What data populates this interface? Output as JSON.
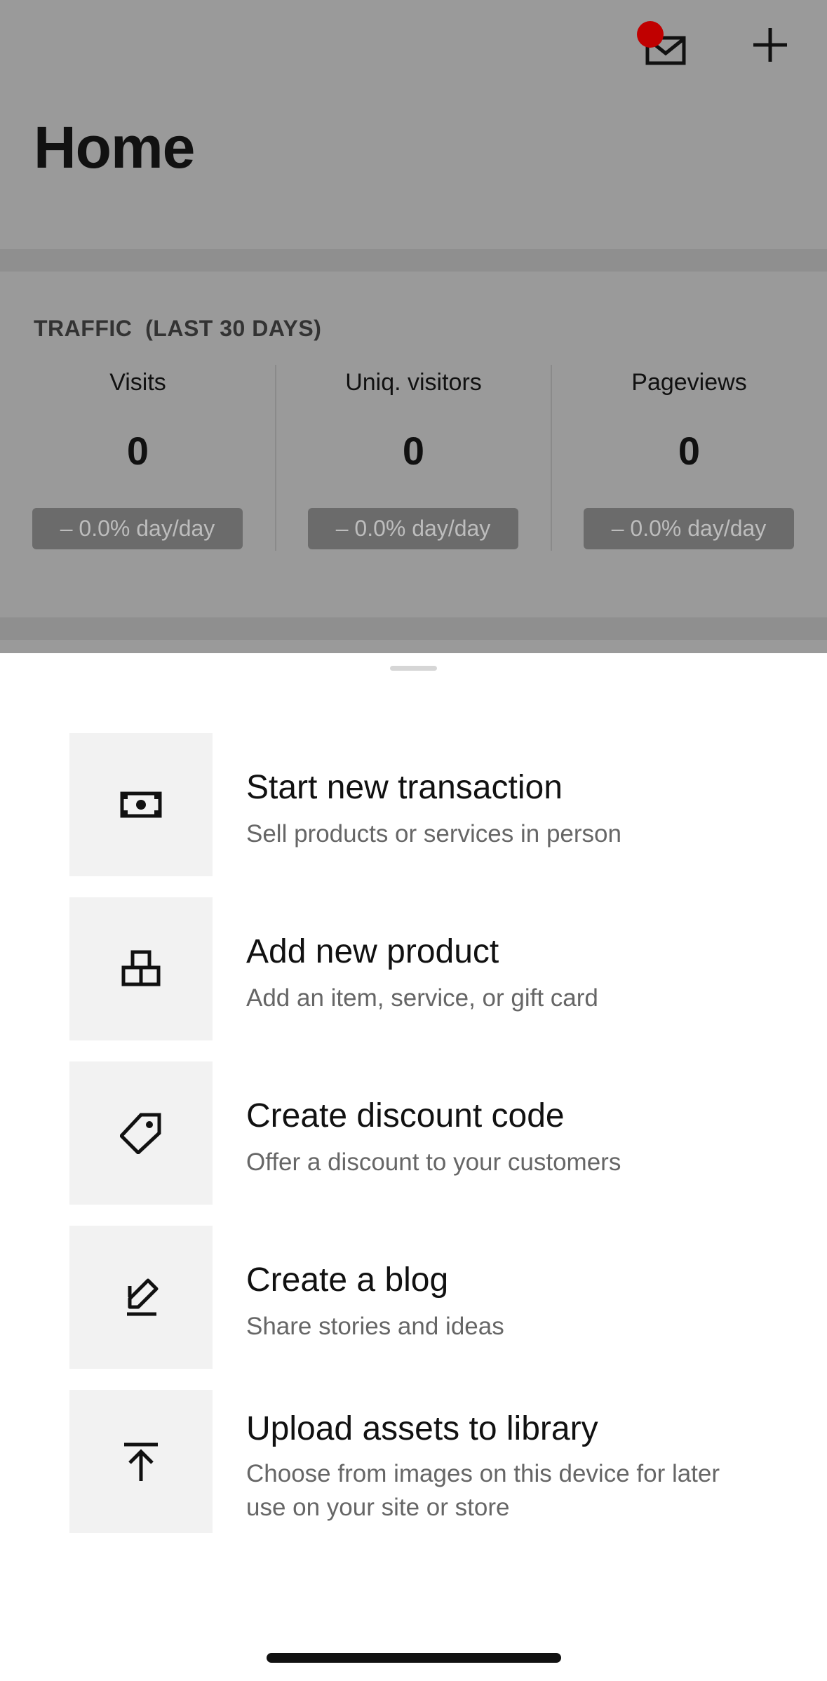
{
  "header": {
    "title": "Home",
    "mail_icon": "mail-icon",
    "add_icon": "plus-icon",
    "notification_color": "#c00000"
  },
  "traffic": {
    "label": "TRAFFIC  (LAST 30 DAYS)",
    "stats": [
      {
        "label": "Visits",
        "value": "0",
        "change": "– 0.0% day/day"
      },
      {
        "label": "Uniq. visitors",
        "value": "0",
        "change": "– 0.0% day/day"
      },
      {
        "label": "Pageviews",
        "value": "0",
        "change": "– 0.0% day/day"
      }
    ]
  },
  "sheet": {
    "actions": [
      {
        "title": "Start new transaction",
        "subtitle": "Sell products or services in person",
        "icon": "cash-icon"
      },
      {
        "title": "Add new product",
        "subtitle": "Add an item, service, or gift card",
        "icon": "boxes-icon"
      },
      {
        "title": "Create discount code",
        "subtitle": "Offer a discount to your customers",
        "icon": "tag-icon"
      },
      {
        "title": "Create a blog",
        "subtitle": "Share stories and ideas",
        "icon": "pen-icon"
      },
      {
        "title": "Upload assets to library",
        "subtitle": "Choose from images on this device for later use on your site or store",
        "icon": "upload-icon"
      }
    ]
  }
}
